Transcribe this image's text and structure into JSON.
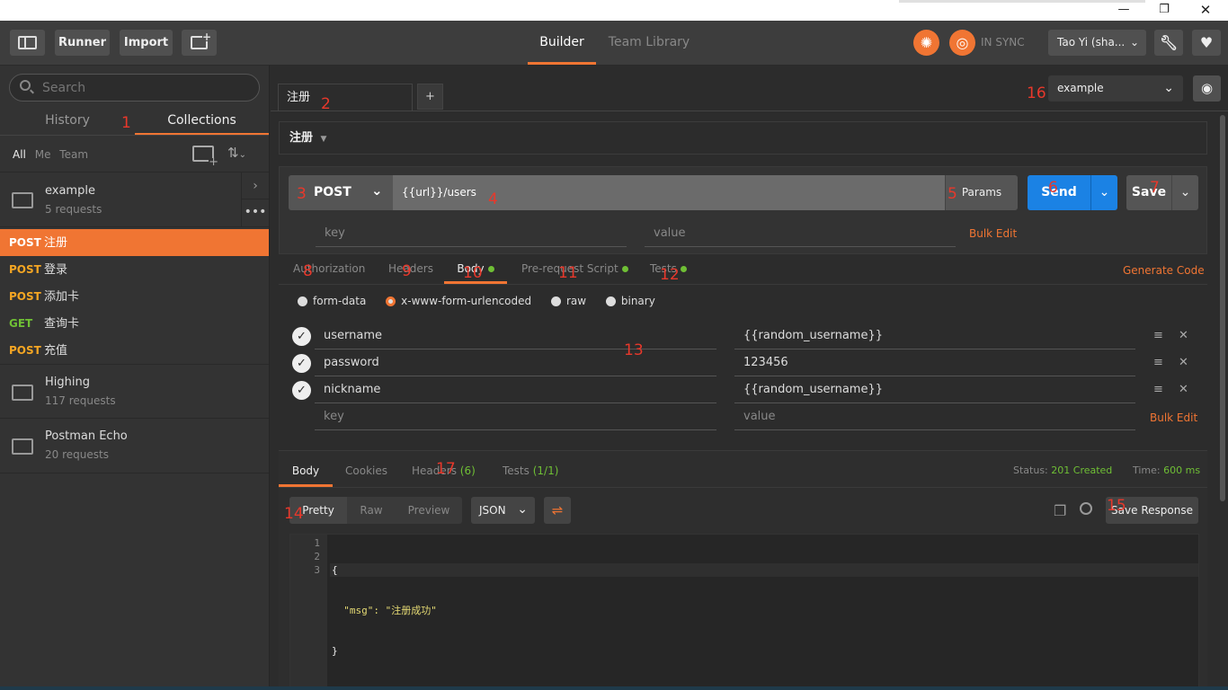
{
  "window": {
    "minimize": "—",
    "restore": "❐",
    "close": "✕"
  },
  "toolbar": {
    "runner": "Runner",
    "import": "Import",
    "tabs": [
      "Builder",
      "Team Library"
    ],
    "sync": "IN SYNC",
    "user": "Tao Yi (sha..."
  },
  "sidebar": {
    "search_placeholder": "Search",
    "tabs": [
      "History",
      "Collections"
    ],
    "filters": [
      "All",
      "Me",
      "Team"
    ],
    "collections": [
      {
        "name": "example",
        "count": "5 requests"
      },
      {
        "name": "Highing",
        "count": "117 requests"
      },
      {
        "name": "Postman Echo",
        "count": "20 requests"
      }
    ],
    "requests": [
      {
        "method": "POST",
        "name": "注册"
      },
      {
        "method": "POST",
        "name": "登录"
      },
      {
        "method": "POST",
        "name": "添加卡"
      },
      {
        "method": "GET",
        "name": "查询卡"
      },
      {
        "method": "POST",
        "name": "充值"
      }
    ]
  },
  "request": {
    "tab_title": "注册",
    "add_tab": "+",
    "name": "注册",
    "environment": "example",
    "method": "POST",
    "url": "{{url}}/users",
    "params_label": "Params",
    "send_label": "Send",
    "save_label": "Save",
    "key_placeholder": "key",
    "value_placeholder": "value",
    "bulk_edit": "Bulk Edit",
    "generate_code": "Generate Code",
    "subtabs": [
      "Authorization",
      "Headers",
      "Body",
      "Pre-request Script",
      "Tests"
    ],
    "body_modes": [
      "form-data",
      "x-www-form-urlencoded",
      "raw",
      "binary"
    ],
    "body_params": [
      {
        "key": "username",
        "value": "{{random_username}}"
      },
      {
        "key": "password",
        "value": "123456"
      },
      {
        "key": "nickname",
        "value": "{{random_username}}"
      }
    ]
  },
  "response": {
    "tabs": [
      "Body",
      "Cookies",
      "Headers",
      "Tests"
    ],
    "headers_count": "(6)",
    "tests_result": "(1/1)",
    "status_label": "Status:",
    "status_value": "201 Created",
    "time_label": "Time:",
    "time_value": "600 ms",
    "view_modes": [
      "Pretty",
      "Raw",
      "Preview"
    ],
    "format": "JSON",
    "save_response": "Save Response",
    "code_lines": [
      "{",
      "  \"msg\": \"注册成功\"",
      "}"
    ],
    "line_numbers": [
      "1",
      "2",
      "3"
    ]
  },
  "annotations": [
    "1",
    "2",
    "3",
    "4",
    "5",
    "6",
    "7",
    "8",
    "9",
    "10",
    "11",
    "12",
    "13",
    "14",
    "15",
    "16",
    "17"
  ],
  "colors": {
    "accent": "#f07533",
    "send": "#1b82e4",
    "post": "#f5a623",
    "get": "#6fbf35",
    "annotation": "#e8382b"
  }
}
